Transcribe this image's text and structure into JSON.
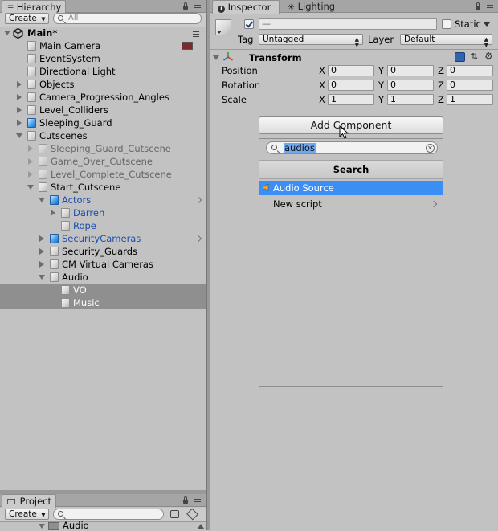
{
  "hierarchy": {
    "tab_label": "Hierarchy",
    "create_label": "Create",
    "search_placeholder": "All",
    "scene_name": "Main*",
    "items": [
      {
        "label": "Main Camera"
      },
      {
        "label": "EventSystem"
      },
      {
        "label": "Directional Light"
      },
      {
        "label": "Objects"
      },
      {
        "label": "Camera_Progression_Angles"
      },
      {
        "label": "Level_Colliders"
      },
      {
        "label": "Sleeping_Guard"
      },
      {
        "label": "Cutscenes"
      },
      {
        "label": "Sleeping_Guard_Cutscene"
      },
      {
        "label": "Game_Over_Cutscene"
      },
      {
        "label": "Level_Complete_Cutscene"
      },
      {
        "label": "Start_Cutscene"
      },
      {
        "label": "Actors"
      },
      {
        "label": "Darren"
      },
      {
        "label": "Rope"
      },
      {
        "label": "SecurityCameras"
      },
      {
        "label": "Security_Guards"
      },
      {
        "label": "CM Virtual Cameras"
      },
      {
        "label": "Audio"
      },
      {
        "label": "VO"
      },
      {
        "label": "Music"
      }
    ]
  },
  "project": {
    "tab_label": "Project",
    "create_label": "Create",
    "folder_label": "Audio"
  },
  "inspector": {
    "tab_label": "Inspector",
    "lighting_tab_label": "Lighting",
    "object_name": "—",
    "static_label": "Static",
    "tag_label": "Tag",
    "tag_value": "Untagged",
    "layer_label": "Layer",
    "layer_value": "Default",
    "transform": {
      "title": "Transform",
      "rows": [
        {
          "label": "Position",
          "x": "0",
          "y": "0",
          "z": "0"
        },
        {
          "label": "Rotation",
          "x": "0",
          "y": "0",
          "z": "0"
        },
        {
          "label": "Scale",
          "x": "1",
          "y": "1",
          "z": "1"
        }
      ],
      "axis_x": "X",
      "axis_y": "Y",
      "axis_z": "Z"
    },
    "add_component_label": "Add Component",
    "popup": {
      "search_value": "audios",
      "header": "Search",
      "items": [
        {
          "label": "Audio Source",
          "selected": true
        },
        {
          "label": "New script",
          "selected": false
        }
      ]
    }
  },
  "colors": {
    "selection_blue": "#3b8ff4",
    "prefab_blue": "#1d4fa8",
    "panel_grey": "#c2c2c2"
  }
}
